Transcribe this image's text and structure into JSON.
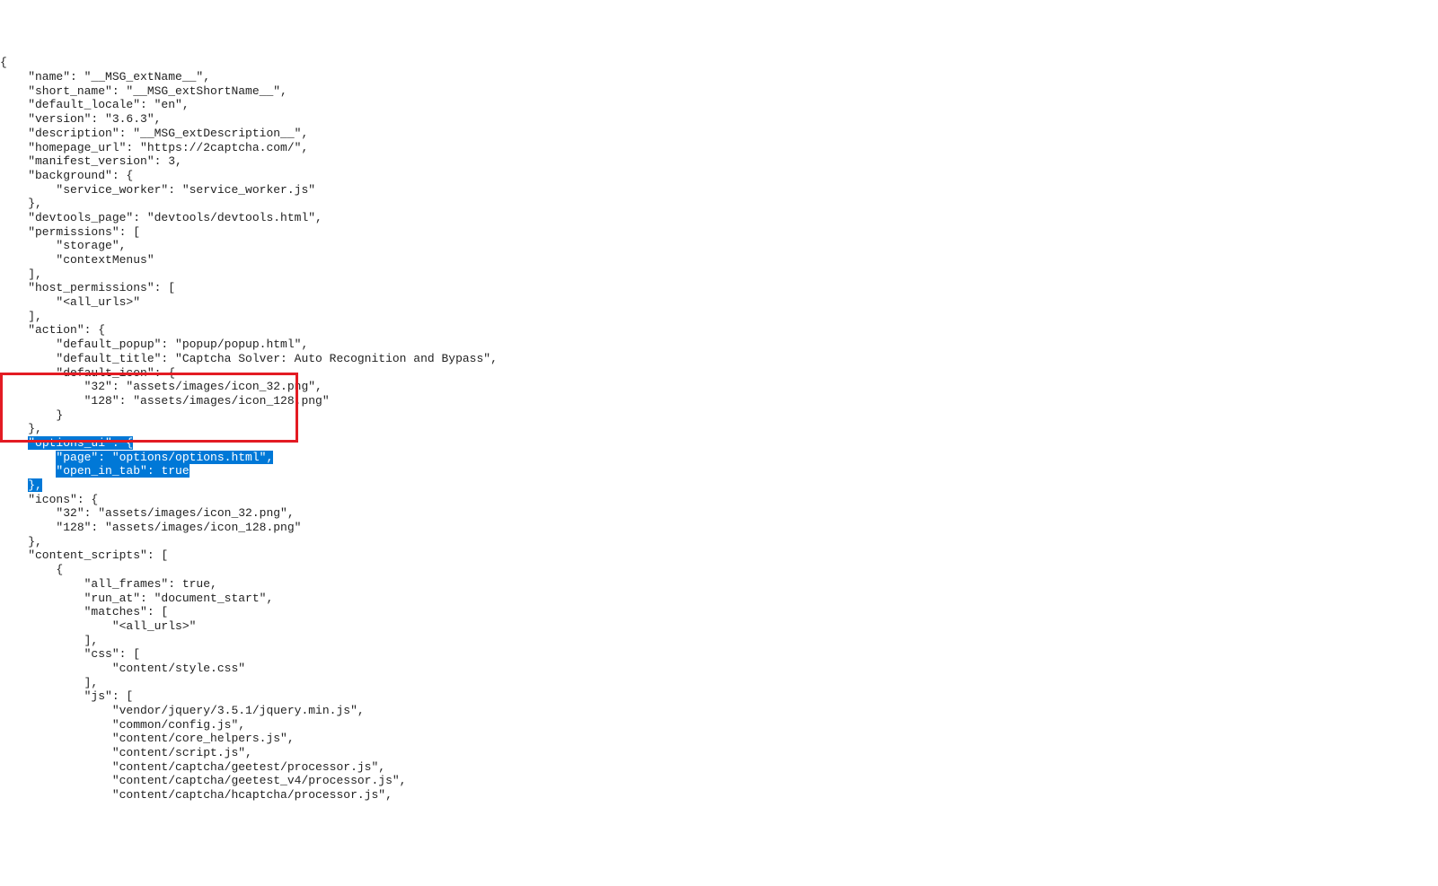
{
  "lines": [
    {
      "text": "{",
      "sel": false
    },
    {
      "text": "    \"name\": \"__MSG_extName__\",",
      "sel": false
    },
    {
      "text": "    \"short_name\": \"__MSG_extShortName__\",",
      "sel": false
    },
    {
      "text": "    \"default_locale\": \"en\",",
      "sel": false
    },
    {
      "text": "    \"version\": \"3.6.3\",",
      "sel": false
    },
    {
      "text": "    \"description\": \"__MSG_extDescription__\",",
      "sel": false
    },
    {
      "text": "    \"homepage_url\": \"https://2captcha.com/\",",
      "sel": false
    },
    {
      "text": "    \"manifest_version\": 3,",
      "sel": false
    },
    {
      "text": "    \"background\": {",
      "sel": false
    },
    {
      "text": "        \"service_worker\": \"service_worker.js\"",
      "sel": false
    },
    {
      "text": "    },",
      "sel": false
    },
    {
      "text": "    \"devtools_page\": \"devtools/devtools.html\",",
      "sel": false
    },
    {
      "text": "    \"permissions\": [",
      "sel": false
    },
    {
      "text": "        \"storage\",",
      "sel": false
    },
    {
      "text": "        \"contextMenus\"",
      "sel": false
    },
    {
      "text": "    ],",
      "sel": false
    },
    {
      "text": "    \"host_permissions\": [",
      "sel": false
    },
    {
      "text": "        \"<all_urls>\"",
      "sel": false
    },
    {
      "text": "    ],",
      "sel": false
    },
    {
      "text": "    \"action\": {",
      "sel": false
    },
    {
      "text": "        \"default_popup\": \"popup/popup.html\",",
      "sel": false
    },
    {
      "text": "        \"default_title\": \"Captcha Solver: Auto Recognition and Bypass\",",
      "sel": false
    },
    {
      "text": "        \"default_icon\": {",
      "sel": false
    },
    {
      "text": "            \"32\": \"assets/images/icon_32.png\",",
      "sel": false
    },
    {
      "text": "            \"128\": \"assets/images/icon_128.png\"",
      "sel": false
    },
    {
      "text": "        }",
      "sel": false
    },
    {
      "text": "    },",
      "sel": false
    },
    {
      "text": "    \"options_ui\": {",
      "sel": true
    },
    {
      "text": "        \"page\": \"options/options.html\",",
      "sel": true
    },
    {
      "text": "        \"open_in_tab\": true",
      "sel": true
    },
    {
      "text": "    },",
      "sel": true
    },
    {
      "text": "    \"icons\": {",
      "sel": false
    },
    {
      "text": "        \"32\": \"assets/images/icon_32.png\",",
      "sel": false
    },
    {
      "text": "        \"128\": \"assets/images/icon_128.png\"",
      "sel": false
    },
    {
      "text": "    },",
      "sel": false
    },
    {
      "text": "    \"content_scripts\": [",
      "sel": false
    },
    {
      "text": "        {",
      "sel": false
    },
    {
      "text": "            \"all_frames\": true,",
      "sel": false
    },
    {
      "text": "            \"run_at\": \"document_start\",",
      "sel": false
    },
    {
      "text": "            \"matches\": [",
      "sel": false
    },
    {
      "text": "                \"<all_urls>\"",
      "sel": false
    },
    {
      "text": "            ],",
      "sel": false
    },
    {
      "text": "            \"css\": [",
      "sel": false
    },
    {
      "text": "                \"content/style.css\"",
      "sel": false
    },
    {
      "text": "            ],",
      "sel": false
    },
    {
      "text": "            \"js\": [",
      "sel": false
    },
    {
      "text": "                \"vendor/jquery/3.5.1/jquery.min.js\",",
      "sel": false
    },
    {
      "text": "                \"common/config.js\",",
      "sel": false
    },
    {
      "text": "                \"content/core_helpers.js\",",
      "sel": false
    },
    {
      "text": "                \"content/script.js\",",
      "sel": false
    },
    {
      "text": "                \"content/captcha/geetest/processor.js\",",
      "sel": false
    },
    {
      "text": "                \"content/captcha/geetest_v4/processor.js\",",
      "sel": false
    },
    {
      "text": "                \"content/captcha/hcaptcha/processor.js\",",
      "sel": false
    }
  ]
}
